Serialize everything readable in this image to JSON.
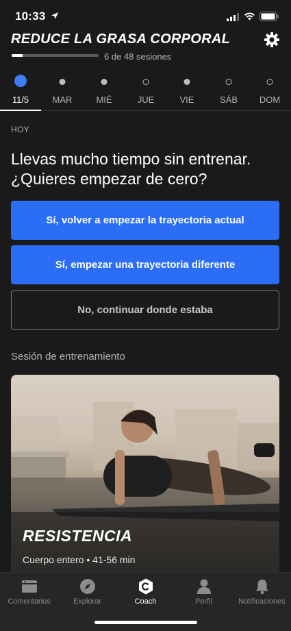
{
  "status_bar": {
    "time": "10:33"
  },
  "header": {
    "title": "REDUCE LA GRASA CORPORAL",
    "progress_text": "6 de 48 sesiones",
    "progress_fraction": 0.125
  },
  "week": {
    "days": [
      {
        "label": "11/5",
        "dot": "active"
      },
      {
        "label": "MAR",
        "dot": "filled"
      },
      {
        "label": "MIÉ",
        "dot": "filled"
      },
      {
        "label": "JUE",
        "dot": "empty"
      },
      {
        "label": "VIE",
        "dot": "filled"
      },
      {
        "label": "SÁB",
        "dot": "empty"
      },
      {
        "label": "DOM",
        "dot": "empty"
      }
    ]
  },
  "today": {
    "section_label": "HOY",
    "question": "Llevas mucho tiempo sin entrenar. ¿Quieres empezar de cero?",
    "buttons": {
      "restart_current": "Sí, volver a empezar la trayectoria actual",
      "start_different": "Sí, empezar una trayectoria diferente",
      "continue": "No, continuar donde estaba"
    }
  },
  "session": {
    "section_label": "Sesión de entrenamiento",
    "card": {
      "title": "RESISTENCIA",
      "meta": "Cuerpo entero • 41-56 min"
    }
  },
  "tabs": [
    {
      "label": "Comentarios",
      "icon": "feed-icon"
    },
    {
      "label": "Explorar",
      "icon": "compass-icon"
    },
    {
      "label": "Coach",
      "icon": "coach-icon",
      "active": true
    },
    {
      "label": "Perfil",
      "icon": "profile-icon"
    },
    {
      "label": "Notificaciones",
      "icon": "bell-icon"
    }
  ],
  "colors": {
    "background": "#1a1a1a",
    "accent": "#2b6ef5",
    "active_dot": "#3d7cf5",
    "tab_bar": "#262626"
  }
}
